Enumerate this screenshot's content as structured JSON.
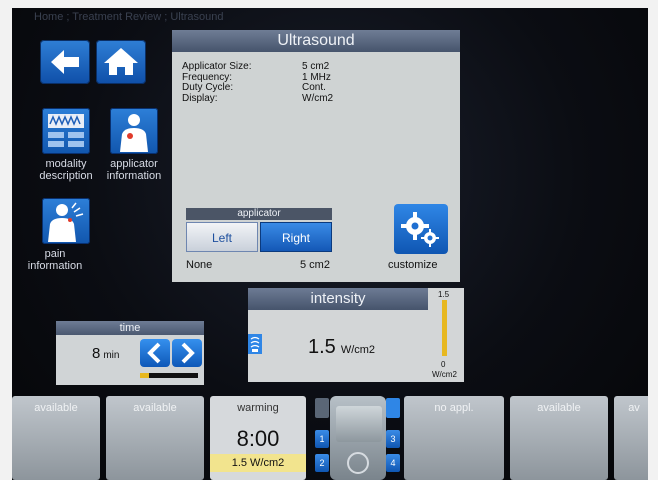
{
  "breadcrumb": "Home ; Treatment Review ; Ultrasound",
  "nav": {
    "back_icon": "arrow-left-icon",
    "home_icon": "home-icon"
  },
  "tiles": {
    "modality": {
      "label_line1": "modality",
      "label_line2": "description",
      "icon": "waveform-icon"
    },
    "applicator": {
      "label_line1": "applicator",
      "label_line2": "information",
      "icon": "body-figure-icon"
    },
    "pain": {
      "label_line1": "pain",
      "label_line2": "information",
      "icon": "pain-figure-icon"
    }
  },
  "panel": {
    "title": "Ultrasound",
    "rows": [
      {
        "key": "Applicator Size:",
        "value": "5 cm2"
      },
      {
        "key": "Frequency:",
        "value": "1 MHz"
      },
      {
        "key": "Duty Cycle:",
        "value": "Cont."
      },
      {
        "key": "Display:",
        "value": "W/cm2"
      }
    ],
    "applicator_header": "applicator",
    "applicator_left": "Left",
    "applicator_right": "Right",
    "applicator_selected": "Right",
    "footer_left": "None",
    "footer_size": "5 cm2",
    "customize_label": "customize",
    "customize_icon": "gears-icon"
  },
  "time": {
    "header": "time",
    "value": "8",
    "unit": "min",
    "progress": 0.15
  },
  "intensity": {
    "header": "intensity",
    "value": "1.5",
    "unit": "W/cm2",
    "scale_max": "1.5",
    "scale_min": "0",
    "scale_unit": "W/cm2"
  },
  "channels": [
    {
      "label": "available"
    },
    {
      "label": "available"
    },
    {
      "label": "warming",
      "time": "8:00",
      "intensity": "1.5 W/cm2"
    },
    {
      "label": "no appl."
    },
    {
      "label": "available"
    },
    {
      "label": "av"
    }
  ],
  "channel_buttons": {
    "one": "1",
    "two": "2",
    "three": "3",
    "four": "4"
  },
  "colors": {
    "accent_blue": "#1f6fd1",
    "panel_gray": "#cfd3d3",
    "progress_yellow": "#e7b820",
    "header_gray": "#5a6780"
  }
}
